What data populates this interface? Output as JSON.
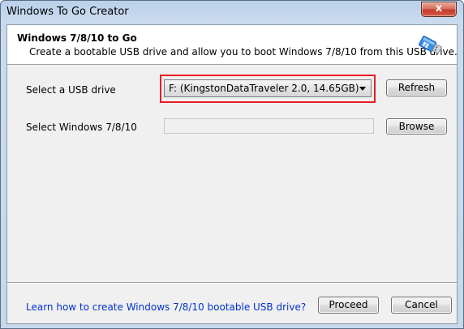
{
  "window": {
    "title": "Windows To Go Creator",
    "close_glyph": "x"
  },
  "header": {
    "title": "Windows 7/8/10 to Go",
    "subtitle": "Create a bootable USB drive and allow you to boot Windows 7/8/10 from this USB drive.",
    "icon": "usb-drive-icon"
  },
  "usb_row": {
    "label": "Select a USB drive",
    "selected_drive": "F: (KingstonDataTraveler 2.0, 14.65GB)",
    "refresh_label": "Refresh"
  },
  "windows_row": {
    "label": "Select Windows 7/8/10",
    "path_value": "",
    "browse_label": "Browse"
  },
  "footer": {
    "help_link": "Learn how to create Windows 7/8/10 bootable USB drive?",
    "proceed_label": "Proceed",
    "cancel_label": "Cancel"
  },
  "colors": {
    "highlight": "#e81c24",
    "link": "#0033cc",
    "titlebar": "#b9d1ea",
    "dialog_bg": "#f0f0f0"
  }
}
